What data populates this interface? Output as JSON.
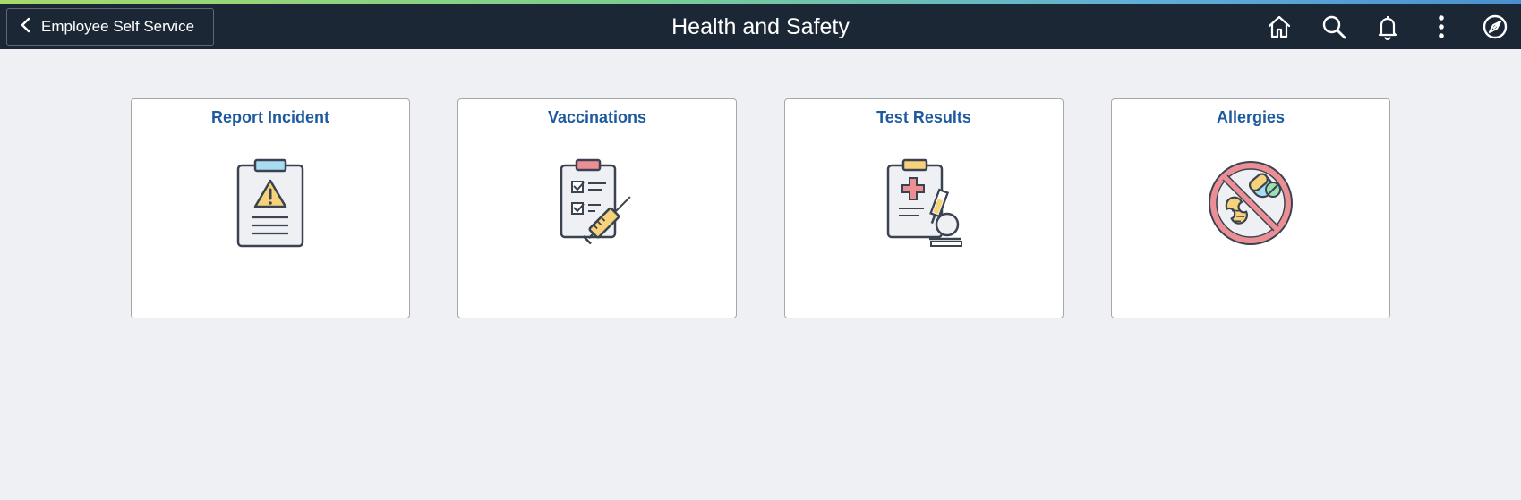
{
  "header": {
    "back_label": "Employee Self Service",
    "title": "Health and Safety",
    "icons": [
      "home-icon",
      "search-icon",
      "bell-icon",
      "more-vertical-icon",
      "compass-icon"
    ]
  },
  "tiles": [
    {
      "title": "Report Incident",
      "icon": "clipboard-warning-icon"
    },
    {
      "title": "Vaccinations",
      "icon": "clipboard-syringe-icon"
    },
    {
      "title": "Test Results",
      "icon": "clipboard-microscope-icon"
    },
    {
      "title": "Allergies",
      "icon": "no-allergens-icon"
    }
  ],
  "colors": {
    "header_bg": "#1c2735",
    "page_bg": "#eff0f4",
    "tile_title": "#1e5aa0",
    "accent_gradient": [
      "#a6d96a",
      "#5fb0d8"
    ]
  }
}
